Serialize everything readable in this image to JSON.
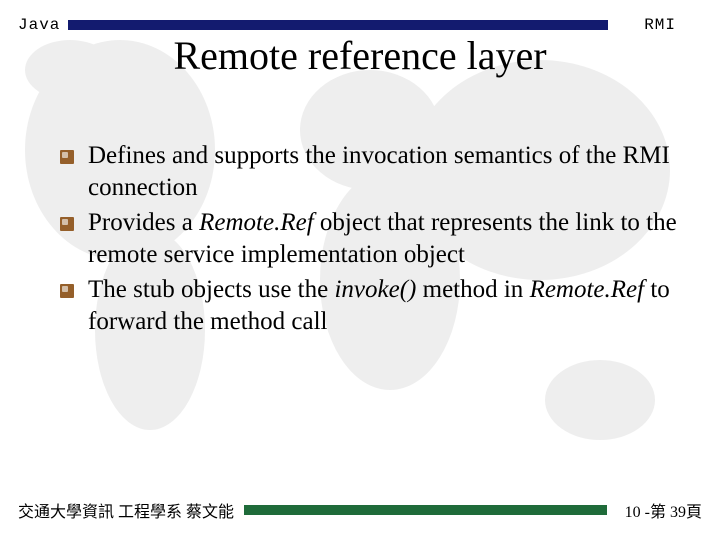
{
  "header": {
    "left": "Java",
    "right": "RMI",
    "bar_color": "#131b6f"
  },
  "title": "Remote reference layer",
  "bullets": [
    {
      "html": "Defines and supports the invocation semantics of the RMI connection"
    },
    {
      "html": "Provides a <i>Remote.Ref</i> object that represents the link to the remote service implementation object"
    },
    {
      "html": "The stub objects use the <i>invoke()</i> method in <i>Remote.Ref</i> to forward the method call"
    }
  ],
  "footer": {
    "left": "交通大學資訊 工程學系 蔡文能",
    "right": "10 -第 39頁",
    "bar_color": "#1f6b3a"
  }
}
